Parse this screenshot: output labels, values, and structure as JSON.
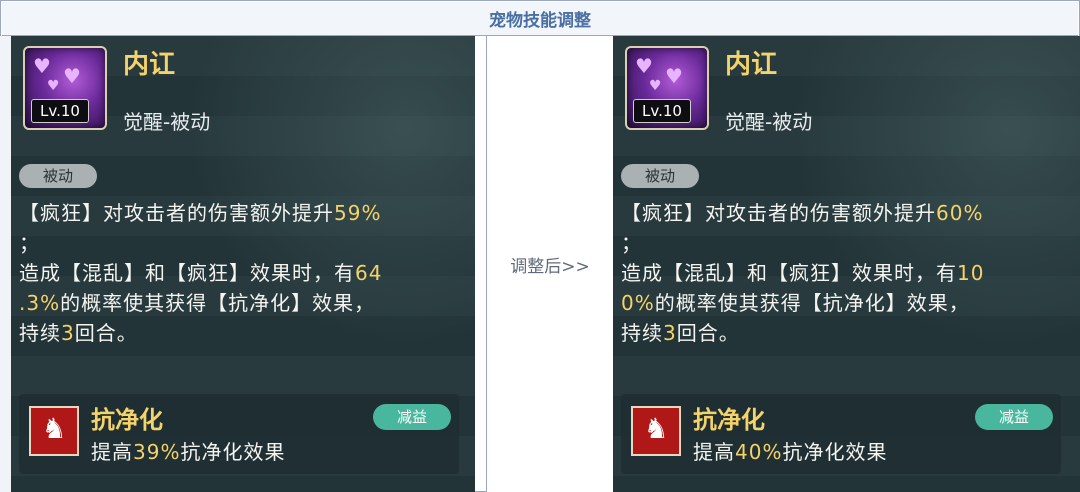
{
  "title": "宠物技能调整",
  "middle_label": "调整后>>",
  "left": {
    "level": "Lv.10",
    "name": "内讧",
    "type": "觉醒-被动",
    "tag": "被动",
    "desc_line1_a": "【疯狂】对攻击者的伤害额外提升",
    "desc_line1_hl": "59%",
    "desc_line2": "；",
    "desc_line3_a": "造成【混乱】和【疯狂】效果时，有",
    "desc_line3_hl": "64",
    "desc_line4_hl": ".3%",
    "desc_line4_b": "的概率使其获得【抗净化】效果，",
    "desc_line5_a": "持续",
    "desc_line5_hl": "3",
    "desc_line5_b": "回合。",
    "effect_name": "抗净化",
    "effect_badge": "减益",
    "effect_desc_a": "提高",
    "effect_desc_hl": "39%",
    "effect_desc_b": "抗净化效果"
  },
  "right": {
    "level": "Lv.10",
    "name": "内讧",
    "type": "觉醒-被动",
    "tag": "被动",
    "desc_line1_a": "【疯狂】对攻击者的伤害额外提升",
    "desc_line1_hl": "60%",
    "desc_line2": "；",
    "desc_line3_a": "造成【混乱】和【疯狂】效果时，有",
    "desc_line3_hl": "10",
    "desc_line4_hl": "0%",
    "desc_line4_b": "的概率使其获得【抗净化】效果，",
    "desc_line5_a": "持续",
    "desc_line5_hl": "3",
    "desc_line5_b": "回合。",
    "effect_name": "抗净化",
    "effect_badge": "减益",
    "effect_desc_a": "提高",
    "effect_desc_hl": "40%",
    "effect_desc_b": "抗净化效果"
  },
  "colors": {
    "highlight": "#f4d36a",
    "panel_bg": "#24363a",
    "badge": "#49b79d",
    "title_text": "#4a6fa5"
  },
  "icons": {
    "skill": "purple-hearts-icon",
    "effect": "anti-purify-icon"
  }
}
